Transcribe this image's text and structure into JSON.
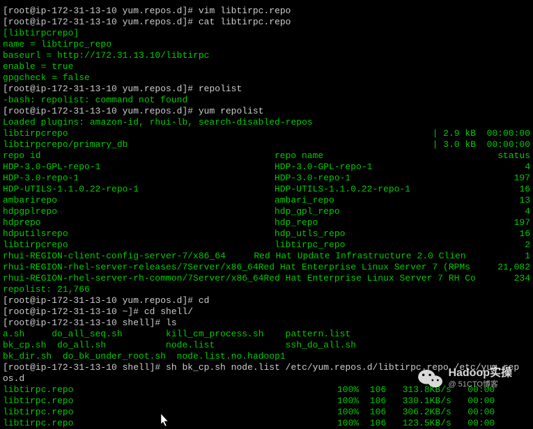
{
  "prompts": {
    "p1": "[root@ip-172-31-13-10 yum.repos.d]# ",
    "p2": "[root@ip-172-31-13-10 ~]# ",
    "p3": "[root@ip-172-31-13-10 shell]# "
  },
  "commands": {
    "vim": "vim libtirpc.repo",
    "cat": "cat libtirpc.repo",
    "repolist": "repolist",
    "yum_repolist": "yum repolist",
    "cd": "cd",
    "cd_shell": "cd shell/",
    "ls": "ls",
    "bkcp": "sh bk_cp.sh node.list /etc/yum.repos.d/libtirpc.repo /etc/yum.rep"
  },
  "repo_file": {
    "l1": "[libtirpcrepo]",
    "l2": "name = libtirpc_repo",
    "l3": "baseurl = http://172.31.13.10/libtirpc",
    "l4": "enable = true",
    "l5": "gpgcheck = false"
  },
  "errors": {
    "notfound": "-bash: repolist: command not found"
  },
  "yum": {
    "plugins": "Loaded plugins: amazon-id, rhui-lb, search-disabled-repos",
    "dl1_name": "libtirpcrepo",
    "dl1_stat": "| 2.9 kB  00:00:00",
    "dl2_name": "libtirpcrepo/primary_db",
    "dl2_stat": "| 3.0 kB  00:00:00",
    "hdr_id": "repo id",
    "hdr_name": "repo name",
    "hdr_status": "status",
    "repos": [
      {
        "id": "HDP-3.0-GPL-repo-1",
        "name": "HDP-3.0-GPL-repo-1",
        "status": "4"
      },
      {
        "id": "HDP-3.0-repo-1",
        "name": "HDP-3.0-repo-1",
        "status": "197"
      },
      {
        "id": "HDP-UTILS-1.1.0.22-repo-1",
        "name": "HDP-UTILS-1.1.0.22-repo-1",
        "status": "16"
      },
      {
        "id": "ambarirepo",
        "name": "ambari_repo",
        "status": "13"
      },
      {
        "id": "hdpgplrepo",
        "name": "hdp_gpl_repo",
        "status": "4"
      },
      {
        "id": "hdprepo",
        "name": "hdp_repo",
        "status": "197"
      },
      {
        "id": "hdputilsrepo",
        "name": "hdp_utls_repo",
        "status": "16"
      },
      {
        "id": "libtirpcrepo",
        "name": "libtirpc_repo",
        "status": "2"
      },
      {
        "id": "rhui-REGION-client-config-server-7/x86_64",
        "name": "Red Hat Update Infrastructure 2.0 Clien",
        "status": "1"
      },
      {
        "id": "rhui-REGION-rhel-server-releases/7Server/x86_64",
        "name": "Red Hat Enterprise Linux Server 7 (RPMs",
        "status": "21,082"
      },
      {
        "id": "rhui-REGION-rhel-server-rh-common/7Server/x86_64",
        "name": "Red Hat Enterprise Linux Server 7 RH Co",
        "status": "234"
      }
    ],
    "total": "repolist: 21,766"
  },
  "ls": {
    "r1": "a.sh     do_all_seq.sh        kill_cm_process.sh    pattern.list",
    "r2": "bk_cp.sh  do_all.sh           node.list             ssh_do_all.sh",
    "r3": "bk_dir.sh  do_bk_under_root.sh  node.list.no.hadoop1"
  },
  "bkcp_cont": "os.d",
  "transfers": [
    {
      "name": "libtirpc.repo",
      "stat": "100%  106   313.8KB/s   00:00"
    },
    {
      "name": "libtirpc.repo",
      "stat": "100%  106   330.1KB/s   00:00"
    },
    {
      "name": "libtirpc.repo",
      "stat": "100%  106   306.2KB/s   00:00"
    },
    {
      "name": "libtirpc.repo",
      "stat": "100%  106   123.5KB/s   00:00"
    }
  ],
  "watermark": {
    "text": "Hadoop实操",
    "sub": "@ 51CTO博客"
  }
}
